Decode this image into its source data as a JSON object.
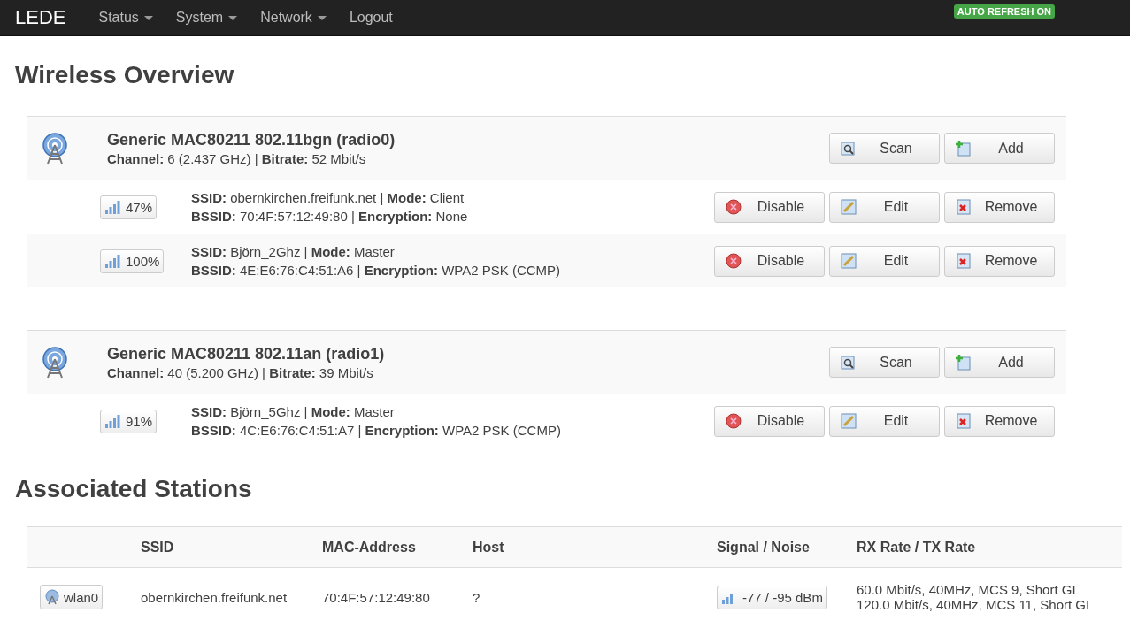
{
  "navbar": {
    "brand": "LEDE",
    "menu": [
      {
        "label": "Status",
        "dropdown": true
      },
      {
        "label": "System",
        "dropdown": true
      },
      {
        "label": "Network",
        "dropdown": true
      },
      {
        "label": "Logout",
        "dropdown": false
      }
    ],
    "badge": "AUTO REFRESH ON"
  },
  "title": "Wireless Overview",
  "radios": [
    {
      "name": "Generic MAC80211 802.11bgn (radio0)",
      "info": "**Channel:** 6 (2.437 GHz) | **Bitrate:** 52 Mbit/s",
      "buttons": [
        {
          "kind": "scan",
          "label": "Scan"
        },
        {
          "kind": "add",
          "label": "Add"
        }
      ],
      "networks": [
        {
          "signal": "47%",
          "line1": "**SSID:** obernkirchen.freifunk.net | **Mode:** Client",
          "line2": "**BSSID:** 70:4F:57:12:49:80 | **Encryption:** None",
          "buttons": [
            {
              "kind": "disable",
              "label": "Disable"
            },
            {
              "kind": "edit",
              "label": "Edit"
            },
            {
              "kind": "remove",
              "label": "Remove"
            }
          ]
        },
        {
          "signal": "100%",
          "line1": "**SSID:** Björn_2Ghz | **Mode:** Master",
          "line2": "**BSSID:** 4E:E6:76:C4:51:A6 | **Encryption:** WPA2 PSK (CCMP)",
          "buttons": [
            {
              "kind": "disable",
              "label": "Disable"
            },
            {
              "kind": "edit",
              "label": "Edit"
            },
            {
              "kind": "remove",
              "label": "Remove"
            }
          ]
        }
      ]
    },
    {
      "name": "Generic MAC80211 802.11an (radio1)",
      "info": "**Channel:** 40 (5.200 GHz) | **Bitrate:** 39 Mbit/s",
      "buttons": [
        {
          "kind": "scan",
          "label": "Scan"
        },
        {
          "kind": "add",
          "label": "Add"
        }
      ],
      "networks": [
        {
          "signal": "91%",
          "line1": "**SSID:** Björn_5Ghz | **Mode:** Master",
          "line2": "**BSSID:** 4C:E6:76:C4:51:A7 | **Encryption:** WPA2 PSK (CCMP)",
          "buttons": [
            {
              "kind": "disable",
              "label": "Disable"
            },
            {
              "kind": "edit",
              "label": "Edit"
            },
            {
              "kind": "remove",
              "label": "Remove"
            }
          ]
        }
      ]
    }
  ],
  "stations_title": "Associated Stations",
  "stations": {
    "columns": [
      "SSID",
      "MAC-Address",
      "Host",
      "Signal / Noise",
      "RX Rate / TX Rate"
    ],
    "rows": [
      {
        "interface": "wlan0",
        "ssid": "obernkirchen.freifunk.net",
        "mac": "70:4F:57:12:49:80",
        "host": "?",
        "signal": "-77 / -95 dBm",
        "rx_rate": "60.0 Mbit/s, 40MHz, MCS 9, Short GI",
        "tx_rate": "120.0 Mbit/s, 40MHz, MCS 11, Short GI"
      }
    ]
  }
}
